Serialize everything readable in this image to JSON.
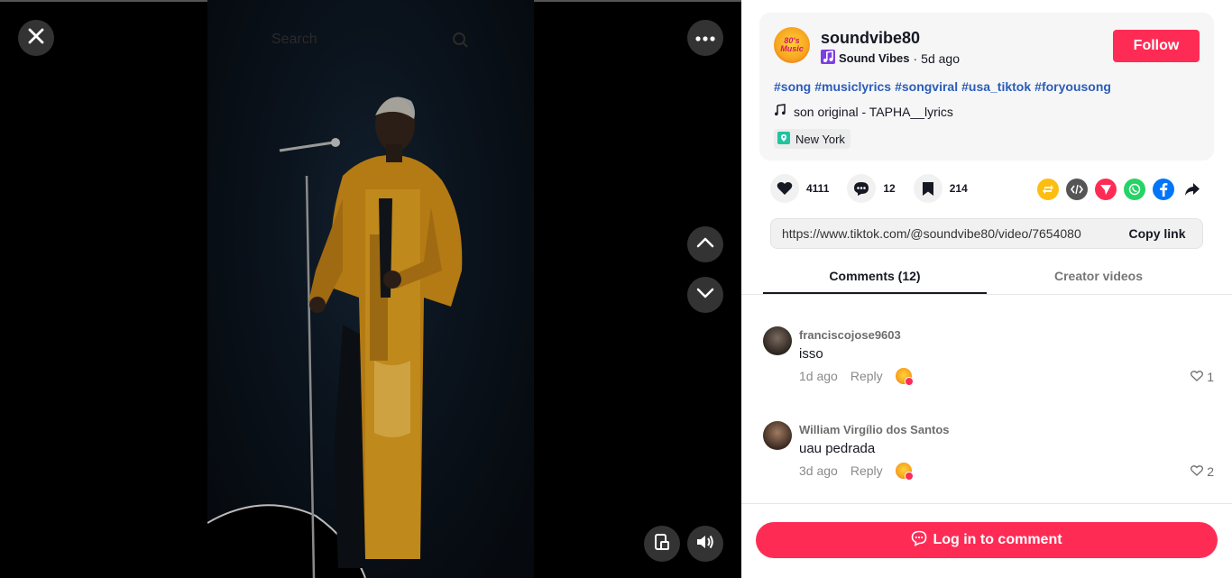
{
  "video": {
    "search_placeholder": "Search"
  },
  "post": {
    "username": "soundvibe80",
    "avatar_text": "80's Music",
    "nickname": "Sound Vibes",
    "separator": "·",
    "posted": "5d ago",
    "follow_label": "Follow",
    "hashtags": [
      "#song",
      "#musiclyrics",
      "#songviral",
      "#usa_tiktok",
      "#foryousong"
    ],
    "sound": "son original - TAPHA__lyrics",
    "location": "New York"
  },
  "actions": {
    "likes": "4111",
    "comments": "12",
    "saves": "214"
  },
  "link": {
    "url": "https://www.tiktok.com/@soundvibe80/video/7654080",
    "copy_label": "Copy link"
  },
  "tabs": {
    "comments": "Comments (12)",
    "creator": "Creator videos"
  },
  "comments": [
    {
      "user": "franciscojose9603",
      "text": "isso",
      "time": "1d ago",
      "reply": "Reply",
      "likes": "1"
    },
    {
      "user": "William Virgílio dos Santos",
      "text": "uau pedrada",
      "time": "3d ago",
      "reply": "Reply",
      "likes": "2"
    }
  ],
  "footer": {
    "login_label": "Log in to comment"
  },
  "colors": {
    "accent": "#fe2c55",
    "hashtag": "#2b5db9"
  },
  "icons": [
    "close-icon",
    "more-icon",
    "search-icon",
    "chevron-up-icon",
    "chevron-down-icon",
    "pip-icon",
    "volume-icon",
    "heart-icon",
    "comment-icon",
    "bookmark-icon",
    "repost-icon",
    "embed-icon",
    "send-icon",
    "whatsapp-icon",
    "facebook-icon",
    "share-icon",
    "music-note-icon",
    "location-icon"
  ]
}
